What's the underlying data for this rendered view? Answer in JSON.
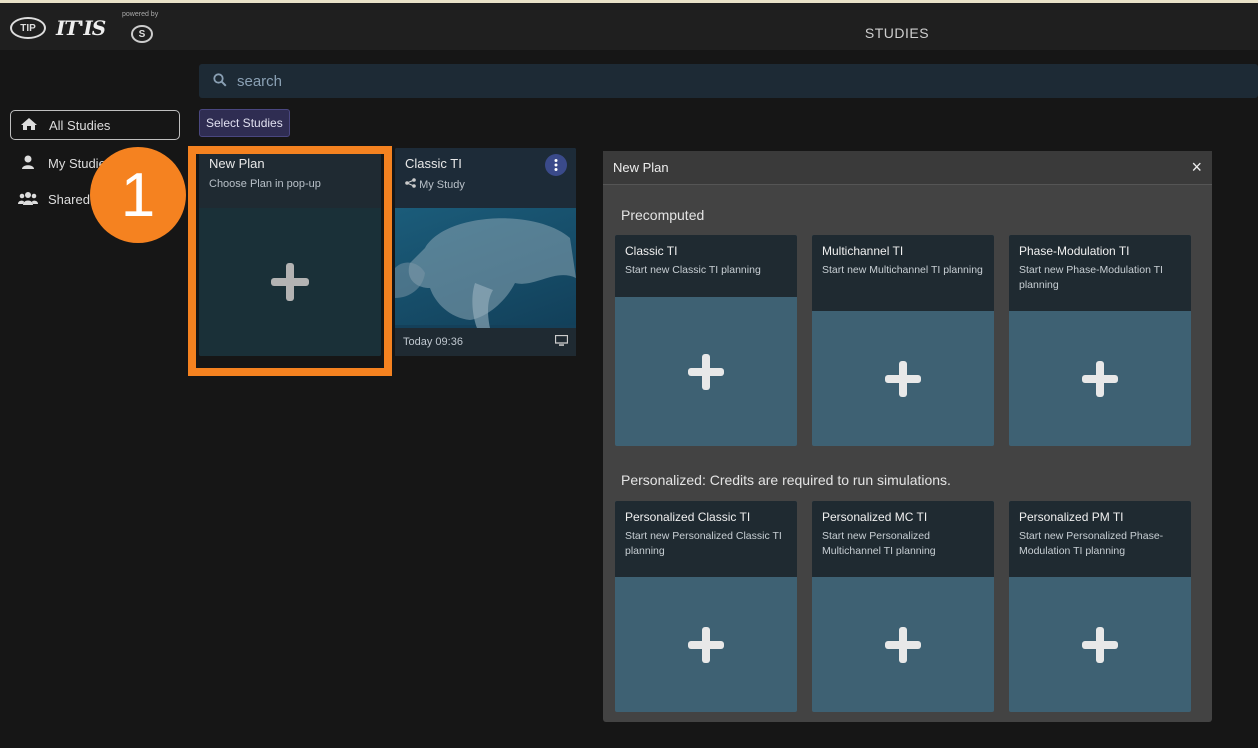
{
  "header": {
    "logo_tip": "TIP",
    "logo_itis": "IT'IS",
    "powered_by": "powered by",
    "logo_s4l": "S",
    "title": "STUDIES"
  },
  "search": {
    "placeholder": "search"
  },
  "sidebar": {
    "items": [
      {
        "label": "All Studies",
        "icon": "home-icon"
      },
      {
        "label": "My Studies",
        "icon": "user-icon"
      },
      {
        "label": "Shared",
        "icon": "users-icon"
      }
    ]
  },
  "toolbar": {
    "select_label": "Select Studies"
  },
  "cards": {
    "new_plan": {
      "title": "New Plan",
      "subtitle": "Choose Plan in pop-up"
    },
    "study": {
      "title": "Classic TI",
      "subtitle": "My Study",
      "date": "Today 09:36"
    }
  },
  "step_badge": "1",
  "modal": {
    "title": "New Plan",
    "close": "×",
    "precomputed_title": "Precomputed",
    "personalized_title": "Personalized: Credits are required to run simulations.",
    "precomputed": [
      {
        "title": "Classic TI",
        "desc": "Start new Classic TI planning"
      },
      {
        "title": "Multichannel TI",
        "desc": "Start new Multichannel TI planning"
      },
      {
        "title": "Phase-Modulation TI",
        "desc": "Start new Phase-Modulation TI planning"
      }
    ],
    "personalized": [
      {
        "title": "Personalized Classic TI",
        "desc": "Start new Personalized Classic TI planning"
      },
      {
        "title": "Personalized MC TI",
        "desc": "Start new Personalized Multichannel TI planning"
      },
      {
        "title": "Personalized PM TI",
        "desc": "Start new Personalized Phase-Modulation TI planning"
      }
    ]
  },
  "colors": {
    "accent": "#f58220",
    "card": "#3e6173",
    "modal": "#434343"
  }
}
